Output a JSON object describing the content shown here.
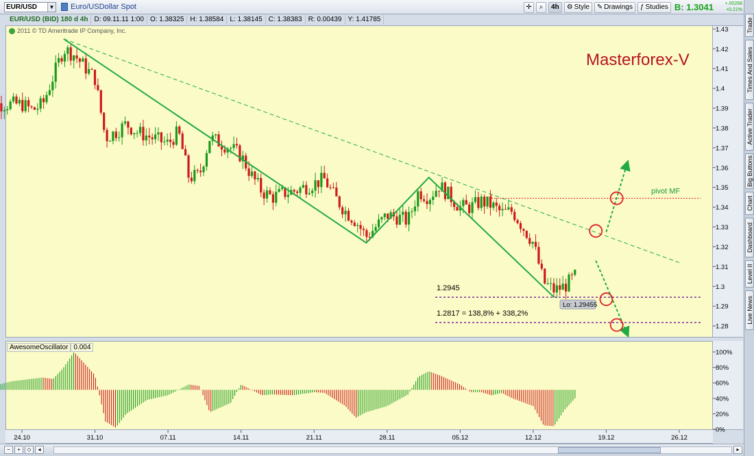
{
  "toolbar": {
    "symbol": "EUR/USD",
    "symbol_description": "Euro/USDollar Spot",
    "period_button": "4h",
    "style_button": "Style",
    "drawings_button": "Drawings",
    "studies_button": "Studies",
    "bid_label": "B: 1.3041",
    "change_abs": "+.00268",
    "change_pct": "+0.21%"
  },
  "info_bar": {
    "symbol": "EUR/USD (BID) 180 d 4h",
    "date": "D: 09.11.11 1:00",
    "open": "O: 1.38325",
    "high": "H: 1.38584",
    "low": "L: 1.38145",
    "close": "C: 1.38383",
    "range": "R: 0.00439",
    "y": "Y: 1.41785"
  },
  "copyright": "2011 © TD Ameritrade IP Company, Inc.",
  "oscillator": {
    "name": "AwesomeOscillator",
    "value": "0.004"
  },
  "sidebar_tabs": [
    "Trade",
    "Times And Sales",
    "Active Trader",
    "Big Buttons",
    "Chart",
    "Dashboard",
    "Level II",
    "Live News"
  ],
  "colors": {
    "chart_bg": "#fbfbc8",
    "up_candle": "#1a9a1a",
    "down_candle": "#cc1a1a",
    "pattern_line": "#22aa44",
    "pivot_line": "#e03030",
    "target_line": "#7a2a9a",
    "watermark": "#b5141e"
  },
  "chart_data": [
    {
      "type": "candlestick",
      "title": "",
      "watermark": "Masterforex-V",
      "x_ticks": [
        "24.10",
        "31.10",
        "07.11",
        "14.11",
        "21.11",
        "28.11",
        "05.12",
        "12.12",
        "19.12",
        "26.12"
      ],
      "y_ticks": [
        "1.28",
        "1.29",
        "1.3",
        "1.31",
        "1.32",
        "1.33",
        "1.34",
        "1.35",
        "1.36",
        "1.37",
        "1.38",
        "1.39",
        "1.4",
        "1.41",
        "1.42",
        "1.43"
      ],
      "ylim": [
        1.2745,
        1.4315
      ],
      "close_path": [
        [
          "20.10",
          1.388
        ],
        [
          "21.10",
          1.392
        ],
        [
          "24.10",
          1.392
        ],
        [
          "25.10",
          1.389
        ],
        [
          "26.10",
          1.392
        ],
        [
          "27.10",
          1.406
        ],
        [
          "28.10",
          1.42
        ],
        [
          "29.10",
          1.417
        ],
        [
          "31.10",
          1.405
        ],
        [
          "01.11",
          1.375
        ],
        [
          "02.11",
          1.378
        ],
        [
          "03.11",
          1.382
        ],
        [
          "04.11",
          1.378
        ],
        [
          "07.11",
          1.372
        ],
        [
          "08.11",
          1.378
        ],
        [
          "09.11",
          1.355
        ],
        [
          "10.11",
          1.356
        ],
        [
          "11.11",
          1.375
        ],
        [
          "13.11",
          1.37
        ],
        [
          "14.11",
          1.366
        ],
        [
          "15.11",
          1.356
        ],
        [
          "16.11",
          1.348
        ],
        [
          "17.11",
          1.345
        ],
        [
          "18.11",
          1.347
        ],
        [
          "19.11",
          1.348
        ],
        [
          "21.11",
          1.352
        ],
        [
          "22.11",
          1.354
        ],
        [
          "23.11",
          1.345
        ],
        [
          "24.11",
          1.338
        ],
        [
          "25.11",
          1.333
        ],
        [
          "26.11",
          1.325
        ],
        [
          "28.11",
          1.336
        ],
        [
          "29.11",
          1.335
        ],
        [
          "30.11",
          1.333
        ],
        [
          "01.12",
          1.348
        ],
        [
          "02.12",
          1.345
        ],
        [
          "03.12",
          1.351
        ],
        [
          "05.12",
          1.34
        ],
        [
          "06.12",
          1.34
        ],
        [
          "07.12",
          1.343
        ],
        [
          "08.12",
          1.341
        ],
        [
          "09.12",
          1.337
        ],
        [
          "10.12",
          1.338
        ],
        [
          "12.12",
          1.322
        ],
        [
          "13.12",
          1.302
        ],
        [
          "14.12",
          1.298
        ],
        [
          "15.12",
          1.3
        ],
        [
          "16.12",
          1.305
        ]
      ],
      "annotations": {
        "pattern_points": [
          [
            "28.10",
            1.425
          ],
          [
            "26.11",
            1.322
          ],
          [
            "02.12",
            1.355
          ],
          [
            "14.12",
            1.2945
          ]
        ],
        "trendline": [
          [
            "28.10",
            1.425
          ],
          [
            "26.12",
            1.312
          ]
        ],
        "pivot": {
          "label": "pivot MF",
          "value": 1.3445,
          "from": "08.12",
          "to": "26.12"
        },
        "levels": [
          {
            "label": "1.2945",
            "value": 1.2945
          },
          {
            "label": "1.2817 = 138,8% + 338,2%",
            "value": 1.2817
          }
        ],
        "low_label": "Lo: 1.29455",
        "arrows": [
          {
            "from": [
              "19.12",
              1.3275
            ],
            "to": [
              "21.12",
              1.362
            ]
          },
          {
            "from": [
              "18.12",
              1.313
            ],
            "to": [
              "21.12",
              1.276
            ]
          }
        ],
        "circles": [
          [
            "20.12",
            1.3445
          ],
          [
            "18.12",
            1.328
          ],
          [
            "19.12",
            1.2935
          ],
          [
            "20.12",
            1.2805
          ]
        ]
      }
    },
    {
      "type": "bar",
      "title": "AwesomeOscillator",
      "y_ticks": [
        "0%",
        "20%",
        "40%",
        "60%",
        "80%",
        "100%"
      ],
      "ylim": [
        0,
        100
      ],
      "baseline": 51,
      "keypoints": [
        [
          "20.10",
          52
        ],
        [
          "23.10",
          62
        ],
        [
          "26.10",
          67
        ],
        [
          "27.10",
          65
        ],
        [
          "28.10",
          80
        ],
        [
          "29.10",
          100
        ],
        [
          "31.10",
          70
        ],
        [
          "01.11",
          10
        ],
        [
          "02.11",
          2
        ],
        [
          "03.11",
          20
        ],
        [
          "05.11",
          38
        ],
        [
          "07.11",
          44
        ],
        [
          "09.11",
          58
        ],
        [
          "10.11",
          56
        ],
        [
          "11.11",
          22
        ],
        [
          "13.11",
          34
        ],
        [
          "14.11",
          58
        ],
        [
          "16.11",
          44
        ],
        [
          "17.11",
          45
        ],
        [
          "19.11",
          44
        ],
        [
          "21.11",
          48
        ],
        [
          "22.11",
          47
        ],
        [
          "24.11",
          30
        ],
        [
          "25.11",
          15
        ],
        [
          "26.11",
          22
        ],
        [
          "28.11",
          30
        ],
        [
          "30.11",
          45
        ],
        [
          "01.12",
          68
        ],
        [
          "02.12",
          75
        ],
        [
          "03.12",
          70
        ],
        [
          "05.12",
          58
        ],
        [
          "06.12",
          48
        ],
        [
          "07.12",
          48
        ],
        [
          "08.12",
          44
        ],
        [
          "09.12",
          47
        ],
        [
          "10.12",
          40
        ],
        [
          "12.12",
          30
        ],
        [
          "13.12",
          5
        ],
        [
          "14.12",
          4
        ],
        [
          "15.12",
          25
        ],
        [
          "16.12",
          40
        ]
      ]
    }
  ]
}
